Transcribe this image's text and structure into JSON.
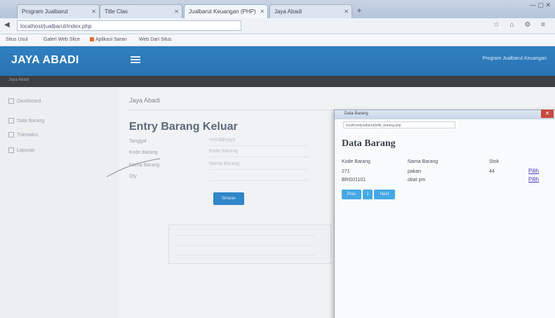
{
  "browser": {
    "tabs": [
      {
        "label": "Program Jualbarut",
        "active": false
      },
      {
        "label": "Title Clas",
        "active": false
      },
      {
        "label": "Jualbarut Keuangan (PHP)",
        "active": true
      },
      {
        "label": "Jaya Abadi",
        "active": false
      }
    ],
    "new_tab": "+",
    "window_controls": "— ▢ ✕",
    "url": "localhost/jualbarut/index.php",
    "bookmarks": [
      {
        "label": "Situs Usul"
      },
      {
        "label": "Galeri Web Slice"
      },
      {
        "label": "Aplikasi Saran",
        "flag": true
      },
      {
        "label": "Web Dari Situs"
      }
    ]
  },
  "app": {
    "brand": "JAYA ABADI",
    "user": "Program Jualbarut Keuangan",
    "colors": {
      "header": "#2f7fc0",
      "subbar": "#3c3f44",
      "button": "#2f86c8",
      "popup_button": "#46a8e6"
    }
  },
  "sidebar": {
    "items": [
      {
        "label": "Dashboard",
        "icon": "dashboard-icon"
      },
      {
        "label": "Data Barang",
        "icon": "list-icon"
      },
      {
        "label": "Transaksi",
        "icon": "pencil-icon"
      },
      {
        "label": "Laporan",
        "icon": "report-icon"
      }
    ]
  },
  "main": {
    "breadcrumb": "Jaya Abadi",
    "form_title": "Entry Barang Keluar",
    "fields": [
      {
        "label": "Tanggal",
        "placeholder": "mm/dd/yyyy"
      },
      {
        "label": "Kode Barang",
        "placeholder": "Kode Barang"
      },
      {
        "label": "Nama Barang",
        "placeholder": "Nama Barang"
      },
      {
        "label": "Qty",
        "placeholder": ""
      }
    ],
    "submit_label": "Simpan"
  },
  "popup": {
    "title": "Data Barang",
    "url": "localhost/jualbarut/pilih_barang.php",
    "heading": "Data Barang",
    "columns": [
      "Kode Barang",
      "Nama Barang",
      "Stok"
    ],
    "rows": [
      {
        "kode": "271",
        "nama": "pakan",
        "stok": "44",
        "action": "Pilih"
      },
      {
        "kode": "BRG01101",
        "nama": "obat pm",
        "stok": "",
        "action": "Pilih"
      }
    ],
    "buttons": [
      "Prev",
      "1",
      "Next"
    ]
  }
}
